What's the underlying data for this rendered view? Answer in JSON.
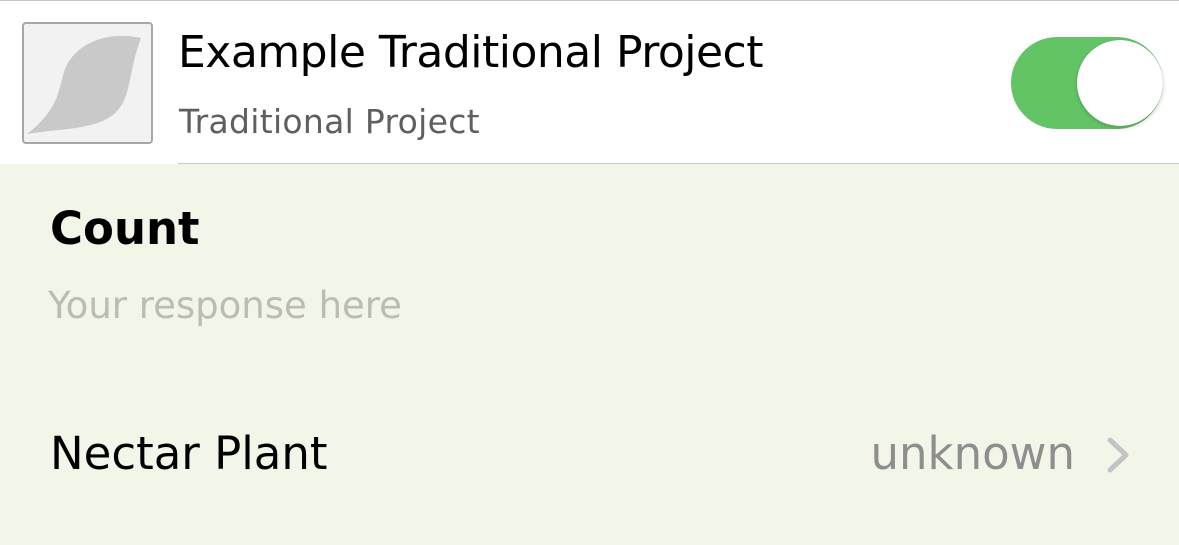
{
  "project": {
    "title": "Example Traditional Project",
    "subtitle": "Traditional Project",
    "thumbnail_icon": "leaf-icon",
    "toggle_on": true,
    "toggle_color": "#63c466"
  },
  "fields": {
    "count": {
      "label": "Count",
      "value": "",
      "placeholder": "Your response here"
    },
    "nectar_plant": {
      "label": "Nectar Plant",
      "value": "unknown",
      "icon": "chevron-right-icon"
    }
  },
  "colors": {
    "background": "#f2f6e9",
    "header_background": "#ffffff",
    "placeholder": "#bbbcb3",
    "secondary_text": "#8e8e8e"
  }
}
